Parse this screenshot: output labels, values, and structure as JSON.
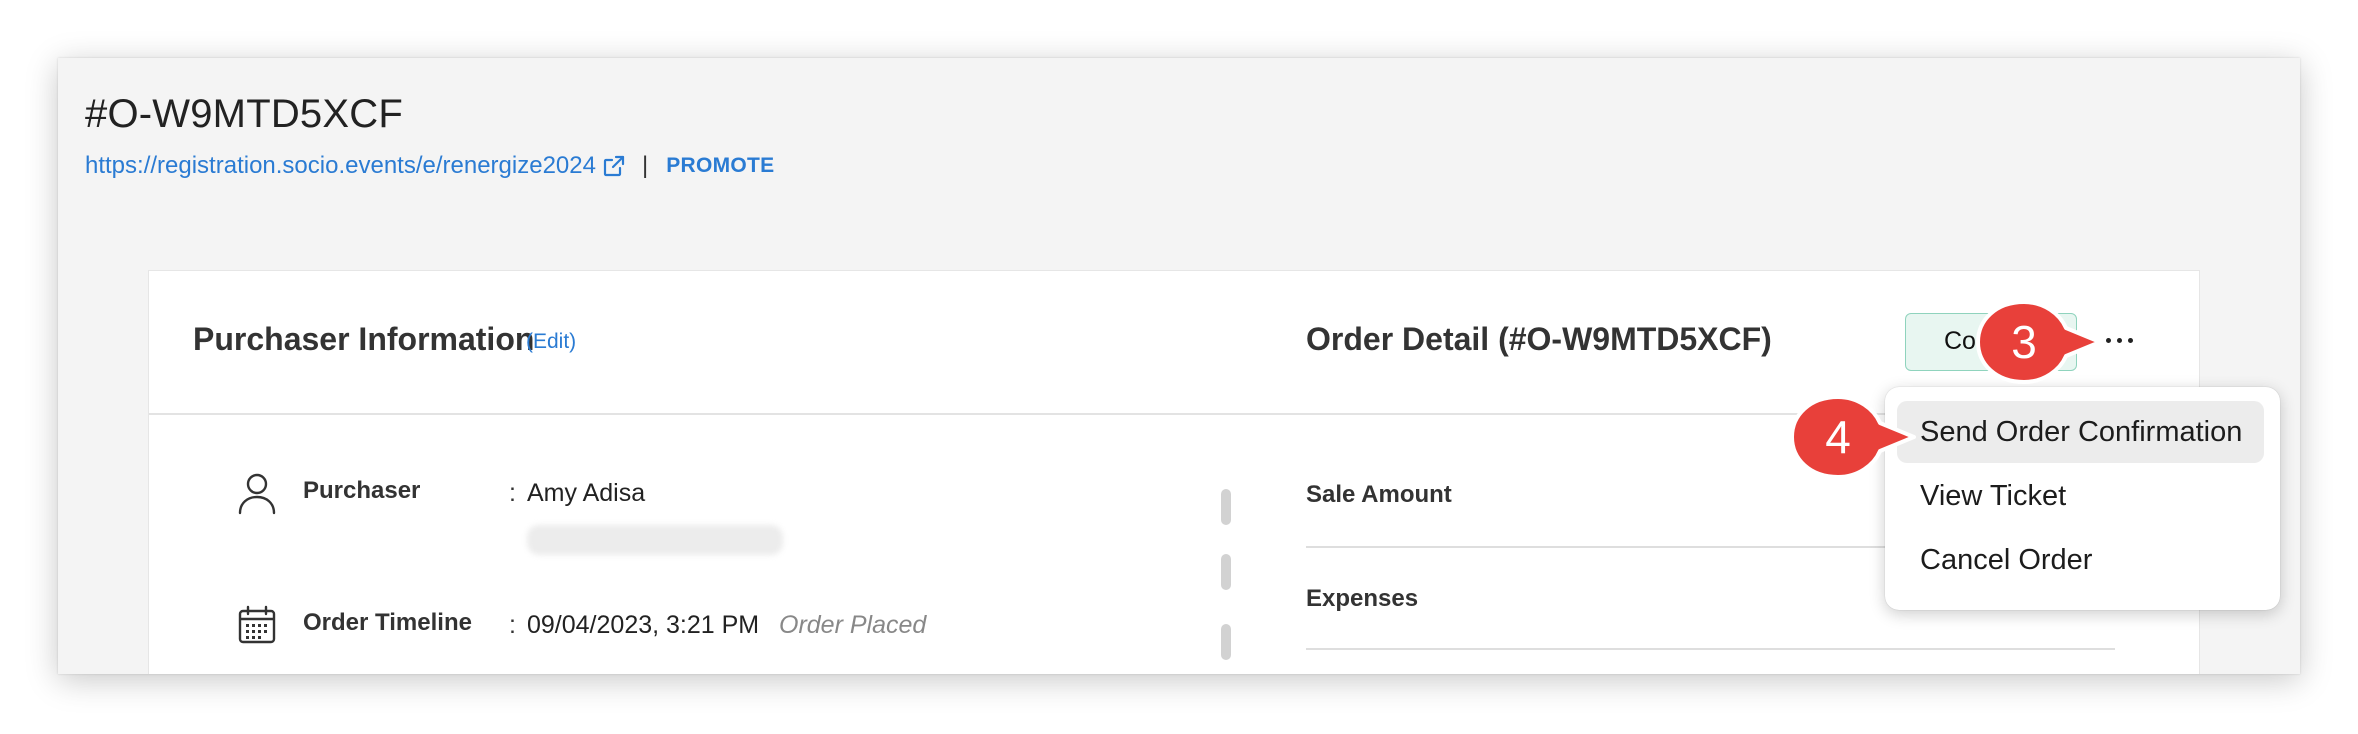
{
  "header": {
    "order_id": "#O-W9MTD5XCF",
    "event_url": "https://registration.socio.events/e/renergize2024",
    "separator": "|",
    "promote_label": "PROMOTE"
  },
  "purchaser_section": {
    "title": "Purchaser Information",
    "edit_label": "(Edit)",
    "fields": [
      {
        "icon": "person-icon",
        "label": "Purchaser",
        "colon": ":",
        "value": "Amy Adisa"
      },
      {
        "icon": "calendar-icon",
        "label": "Order Timeline",
        "colon": ":",
        "value": "09/04/2023, 3:21 PM",
        "status": "Order Placed"
      }
    ]
  },
  "order_section": {
    "title": "Order Detail (#O-W9MTD5XCF)",
    "status_badge": "Completed",
    "more_icon": "ellipsis-icon",
    "rows": [
      {
        "label": "Sale Amount"
      },
      {
        "label": "Expenses"
      }
    ]
  },
  "menu": {
    "items": [
      {
        "label": "Send Order Confirmation",
        "highlighted": true
      },
      {
        "label": "View Ticket"
      },
      {
        "label": "Cancel Order"
      }
    ]
  },
  "annotations": {
    "step_3": "3",
    "step_4": "4",
    "color": "#e8403a"
  },
  "colors": {
    "link": "#2a7bd3",
    "status_bg": "#e8f6f1",
    "status_border": "#8fd3bd",
    "page_bg": "#f4f4f4"
  }
}
